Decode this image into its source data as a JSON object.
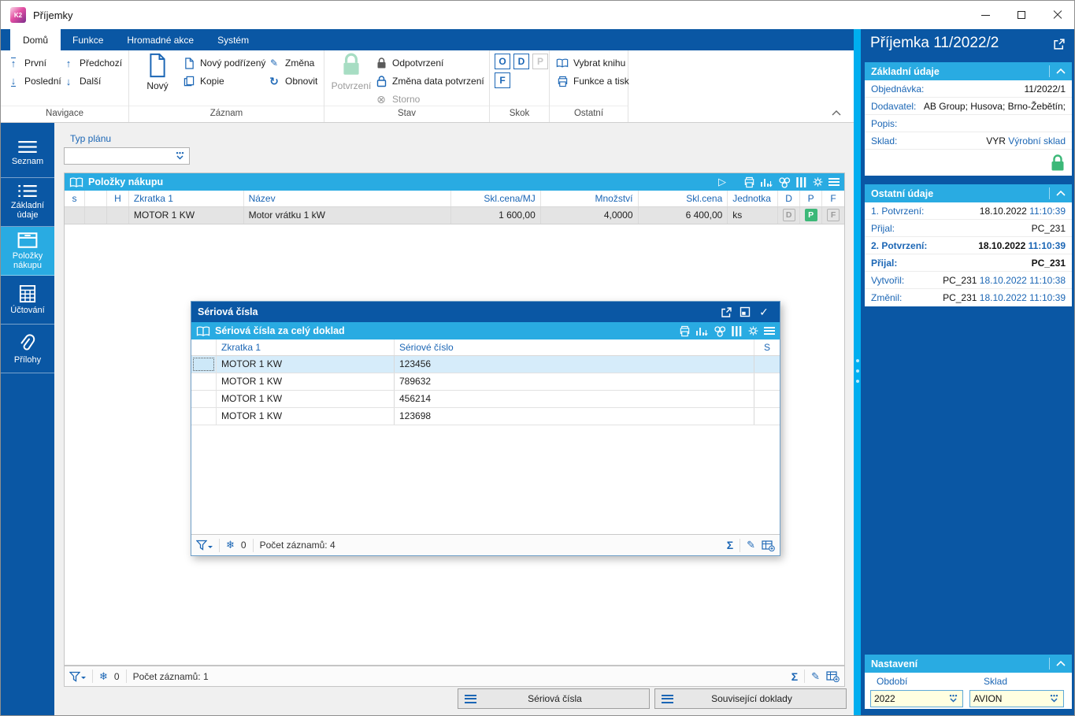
{
  "window": {
    "title": "Příjemky",
    "logo_text": "K2"
  },
  "tabs": [
    {
      "label": "Domů"
    },
    {
      "label": "Funkce"
    },
    {
      "label": "Hromadné akce"
    },
    {
      "label": "Systém"
    }
  ],
  "ribbon": {
    "navigace": {
      "label": "Navigace",
      "first": "První",
      "last": "Poslední",
      "prev": "Předchozí",
      "next": "Další"
    },
    "zaznam": {
      "label": "Záznam",
      "new": "Nový",
      "new_child": "Nový podřízený",
      "copy": "Kopie",
      "change": "Změna",
      "refresh": "Obnovit"
    },
    "stav": {
      "label": "Stav",
      "confirm": "Potvrzení",
      "unconfirm": "Odpotvrzení",
      "change_date": "Změna data potvrzení",
      "cancel": "Storno"
    },
    "skok": {
      "label": "Skok",
      "o": "O",
      "d": "D",
      "p": "P",
      "f": "F"
    },
    "ostatni": {
      "label": "Ostatní",
      "select_book": "Vybrat knihu",
      "func_print": "Funkce a tisk"
    }
  },
  "sidebar": {
    "items": [
      {
        "label": "Seznam"
      },
      {
        "label": "Základní údaje"
      },
      {
        "label": "Položky nákupu"
      },
      {
        "label": "Účtování"
      },
      {
        "label": "Přílohy"
      }
    ]
  },
  "main": {
    "typ_planu_label": "Typ plánu",
    "typ_planu_value": "",
    "grid_title": "Položky nákupu",
    "columns": {
      "s": "s",
      "blank": "",
      "h": "H",
      "zkratka": "Zkratka 1",
      "nazev": "Název",
      "cena_mj": "Skl.cena/MJ",
      "mnozstvi": "Množství",
      "cena": "Skl.cena",
      "jednotka": "Jednotka",
      "d": "D",
      "p": "P",
      "f": "F"
    },
    "row": {
      "zkratka": "MOTOR 1 KW",
      "nazev": "Motor vrátku 1 kW",
      "cena_mj": "1 600,00",
      "mnozstvi": "4,0000",
      "cena": "6 400,00",
      "jednotka": "ks",
      "d": "D",
      "p": "P",
      "f": "F"
    },
    "status": {
      "frozen": "0",
      "count": "Počet záznamů: 1"
    },
    "buttons": {
      "serial": "Sériová čísla",
      "related": "Související doklady"
    }
  },
  "dialog": {
    "title": "Sériová čísla",
    "grid_title": "Sériová čísla za celý doklad",
    "columns": {
      "zkratka": "Zkratka 1",
      "serial": "Sériové číslo",
      "s": "S"
    },
    "rows": [
      {
        "zkratka": "MOTOR 1 KW",
        "serial": "123456"
      },
      {
        "zkratka": "MOTOR 1 KW",
        "serial": "789632"
      },
      {
        "zkratka": "MOTOR 1 KW",
        "serial": "456214"
      },
      {
        "zkratka": "MOTOR 1 KW",
        "serial": "123698"
      }
    ],
    "status": {
      "frozen": "0",
      "count": "Počet záznamů: 4"
    }
  },
  "panel": {
    "title": "Příjemka 11/2022/2",
    "zakladni": {
      "title": "Základní údaje",
      "objednavka_label": "Objednávka:",
      "objednavka": "11/2022/1",
      "dodavatel_label": "Dodavatel:",
      "dodavatel": "AB Group; Husova; Brno-Žebětín;",
      "popis_label": "Popis:",
      "popis": "",
      "sklad_label": "Sklad:",
      "sklad_code": "VYR",
      "sklad_name": "Výrobní sklad"
    },
    "ostatni": {
      "title": "Ostatní údaje",
      "rows": [
        {
          "label": "1. Potvrzení:",
          "dark": "18.10.2022",
          "blue": "11:10:39"
        },
        {
          "label": "Přijal:",
          "dark": "PC_231",
          "blue": ""
        },
        {
          "label": "2. Potvrzení:",
          "dark": "18.10.2022",
          "blue": "11:10:39"
        },
        {
          "label": "Přijal:",
          "dark": "PC_231",
          "blue": ""
        },
        {
          "label": "Vytvořil:",
          "dark": "PC_231",
          "blue": "18.10.2022 11:10:38"
        },
        {
          "label": "Změnil:",
          "dark": "PC_231",
          "blue": "18.10.2022 11:10:39"
        }
      ]
    },
    "nastaveni": {
      "title": "Nastavení",
      "obdobi_label": "Období",
      "obdobi_value": "2022",
      "sklad_label": "Sklad",
      "sklad_value": "AVION"
    }
  },
  "icons": {
    "play": "▷",
    "sigma": "Σ",
    "pencil": "✎",
    "snowflake": "❄",
    "storno_x": "⊗",
    "refresh": "↻",
    "check": "✓",
    "arrow_up": "↑",
    "arrow_down": "↓"
  },
  "colors": {
    "dark_blue": "#0a57a4",
    "accent_blue": "#29abe2",
    "splitter_blue": "#00aeef",
    "green": "#3cb878",
    "link_blue": "#1b66b5",
    "input_yellow": "#ffffe1"
  }
}
